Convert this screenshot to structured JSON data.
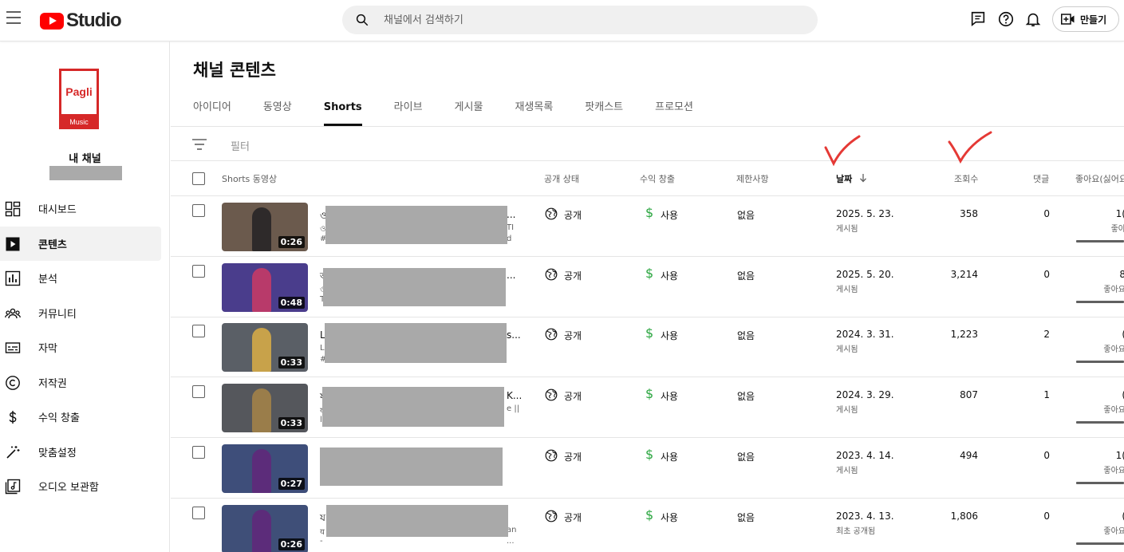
{
  "header": {
    "logo_text": "Studio",
    "search_placeholder": "채널에서 검색하기",
    "create_label": "만들기"
  },
  "sidebar": {
    "channel_logo_text": "Pagli",
    "channel_logo_sub": "Music",
    "channel_label": "내 채널",
    "items": [
      {
        "label": "대시보드",
        "icon": "dashboard-icon"
      },
      {
        "label": "콘텐츠",
        "icon": "content-icon",
        "active": true
      },
      {
        "label": "분석",
        "icon": "analytics-icon"
      },
      {
        "label": "커뮤니티",
        "icon": "community-icon"
      },
      {
        "label": "자막",
        "icon": "subtitles-icon"
      },
      {
        "label": "저작권",
        "icon": "copyright-icon"
      },
      {
        "label": "수익 창출",
        "icon": "dollar-icon"
      },
      {
        "label": "맞춤설정",
        "icon": "magic-wand-icon"
      },
      {
        "label": "오디오 보관함",
        "icon": "audio-library-icon"
      }
    ]
  },
  "main": {
    "title": "채널 콘텐츠",
    "tabs": [
      "아이디어",
      "동영상",
      "Shorts",
      "라이브",
      "게시물",
      "재생목록",
      "팟캐스트",
      "프로모션"
    ],
    "active_tab": "Shorts",
    "filter_label": "필터",
    "columns": {
      "video": "Shorts 동영상",
      "visibility": "공개 상태",
      "monetization": "수익 창출",
      "restrictions": "제한사항",
      "date": "날짜",
      "views": "조회수",
      "comments": "댓글",
      "likes": "좋아요(싫어요"
    },
    "rows": [
      {
        "duration": "0:26",
        "title": "ও",
        "line1": "ও",
        "line2": "#",
        "title_tail": "...",
        "line1_tail": "TI",
        "line2_tail": "d",
        "visibility": "공개",
        "monetization": "사용",
        "restrictions": "없음",
        "date": "2025. 5. 23.",
        "date_status": "게시됨",
        "views": "358",
        "comments": "0",
        "likes": "1(",
        "likes_sub": "좋아"
      },
      {
        "duration": "0:48",
        "title": "অ",
        "line1": "ও",
        "line2": "T",
        "title_tail": "...",
        "line1_tail": "",
        "line2_tail": "",
        "visibility": "공개",
        "monetization": "사용",
        "restrictions": "없음",
        "date": "2025. 5. 20.",
        "date_status": "게시됨",
        "views": "3,214",
        "comments": "0",
        "likes": "8",
        "likes_sub": "좋아요"
      },
      {
        "duration": "0:33",
        "title": "L",
        "line1": "L",
        "line2": "#",
        "title_tail": "s...",
        "line1_tail": "",
        "line2_tail": "",
        "visibility": "공개",
        "monetization": "사용",
        "restrictions": "없음",
        "date": "2024. 3. 31.",
        "date_status": "게시됨",
        "views": "1,223",
        "comments": "2",
        "likes": "(",
        "likes_sub": "좋아요"
      },
      {
        "duration": "0:33",
        "title": "য",
        "line1": "य",
        "line2": "l",
        "title_tail": "K...",
        "line1_tail": "e ||",
        "line2_tail": "",
        "visibility": "공개",
        "monetization": "사용",
        "restrictions": "없음",
        "date": "2024. 3. 29.",
        "date_status": "게시됨",
        "views": "807",
        "comments": "1",
        "likes": "(",
        "likes_sub": "좋아요"
      },
      {
        "duration": "0:27",
        "title": "",
        "line1": "",
        "line2": "",
        "title_tail": "",
        "line1_tail": "",
        "line2_tail": "",
        "visibility": "공개",
        "monetization": "사용",
        "restrictions": "없음",
        "date": "2023. 4. 14.",
        "date_status": "게시됨",
        "views": "494",
        "comments": "0",
        "likes": "1(",
        "likes_sub": "좋아요"
      },
      {
        "duration": "0:26",
        "title": "য",
        "line1": "य",
        "line2": "-",
        "title_tail": "",
        "line1_tail": "an",
        "line2_tail": "...",
        "visibility": "공개",
        "monetization": "사용",
        "restrictions": "없음",
        "date": "2023. 4. 13.",
        "date_status": "최초 공개됨",
        "views": "1,806",
        "comments": "0",
        "likes": "(",
        "likes_sub": "좋아요"
      }
    ]
  },
  "colors": {
    "brand_red": "#ff0000",
    "money_green": "#2ba640",
    "annotation_red": "#e53935"
  }
}
